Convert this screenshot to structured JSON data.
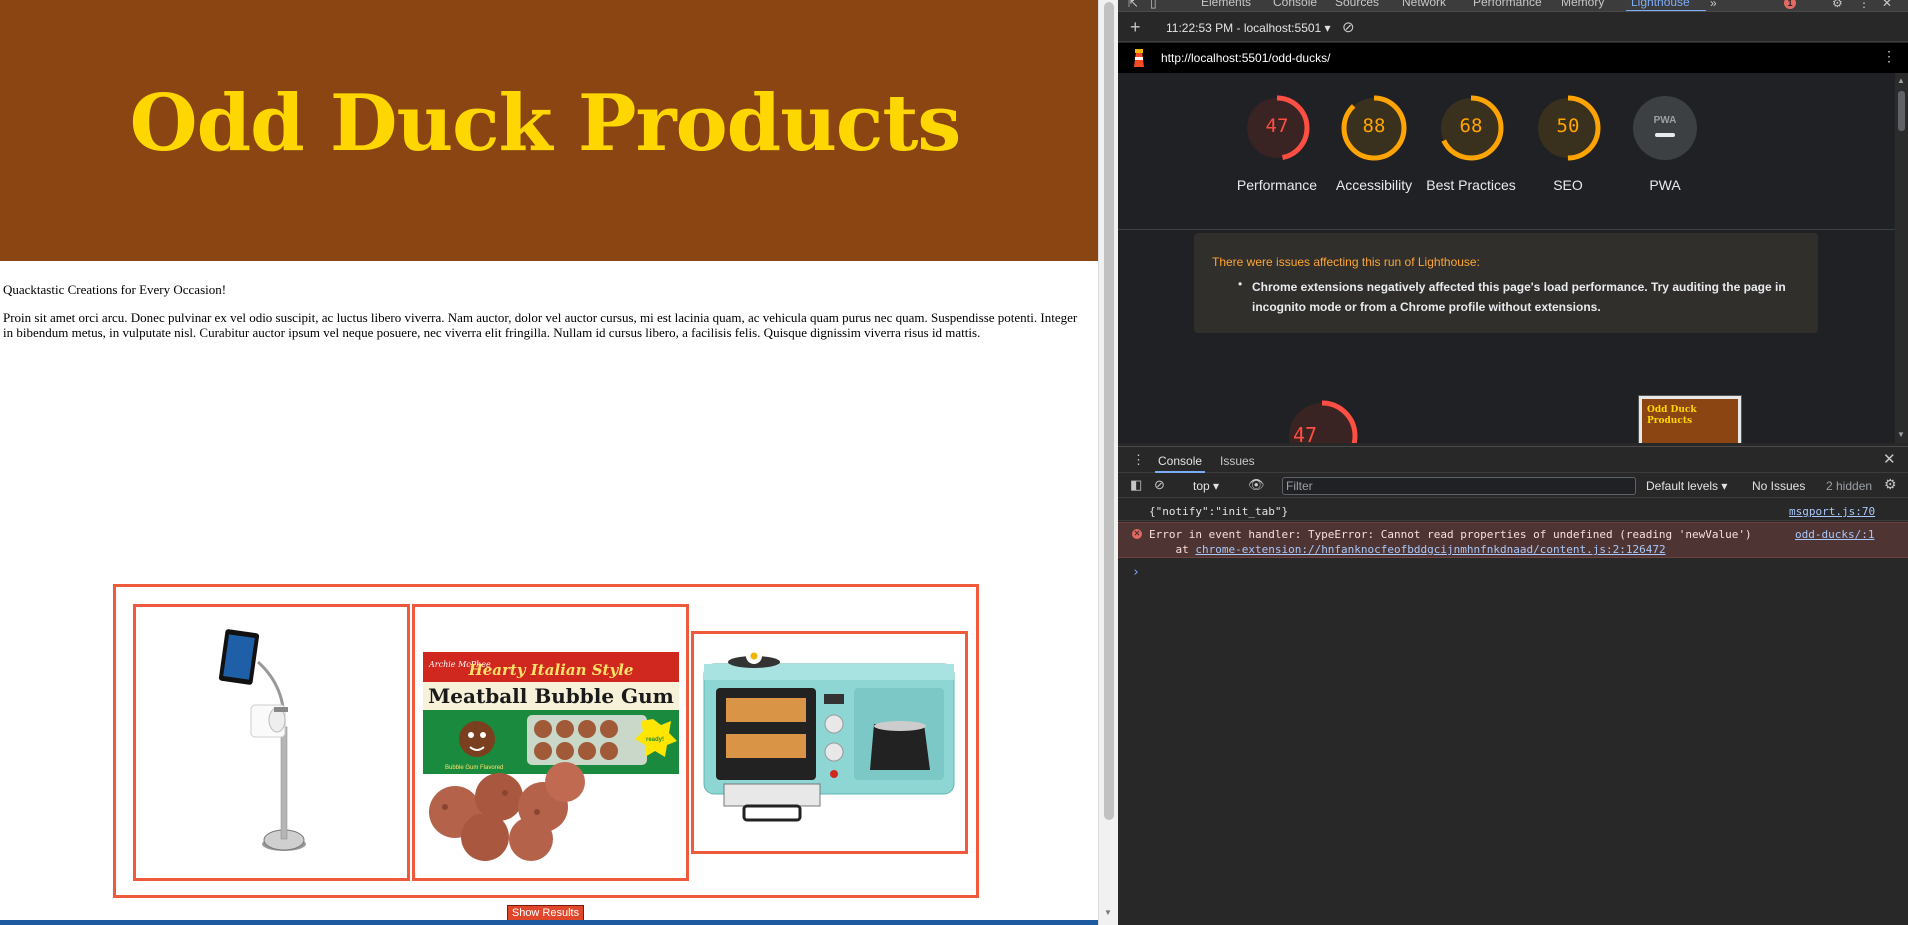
{
  "page": {
    "title": "Odd Duck Products",
    "tagline": "Quacktastic Creations for Every Occasion!",
    "description": "Proin sit amet orci arcu. Donec pulvinar ex vel odio suscipit, ac luctus libero viverra. Nam auctor, dolor vel auctor cursus, mi est lacinia quam, ac vehicula quam purus nec quam. Suspendisse potenti. Integer in bibendum metus, in vulputate nisl. Curabitur auctor ipsum vel neque posuere, nec viverra elit fringilla. Nullam id cursus libero, a facilisis felis. Quisque dignissim viverra risus id mattis.",
    "products": [
      {
        "name": "tablet-stand-toilet-paper-holder"
      },
      {
        "name": "meatball-bubble-gum",
        "box_brand": "Archie McPhee",
        "box_line1": "Hearty Italian Style",
        "box_line2": "Meatball Bubble Gum",
        "badge": "Fully cooked & ready to chew!",
        "footer": "Bubble Gum Flavored"
      },
      {
        "name": "breakfast-station-toaster-oven"
      }
    ],
    "show_results_label": "Show Results",
    "colors": {
      "header_bg": "#8b4513",
      "title": "#ffd700",
      "border": "#f05a3c"
    }
  },
  "devtools": {
    "tabs": [
      "Elements",
      "Console",
      "Sources",
      "Network",
      "Performance",
      "Memory",
      "Lighthouse"
    ],
    "active_tab": "Lighthouse",
    "more_tabs": "»",
    "error_count": "1",
    "lighthouse": {
      "run_label": "11:22:53 PM - localhost:5501 ▾",
      "url": "http://localhost:5501/odd-ducks/",
      "scores": [
        {
          "label": "Performance",
          "value": 47,
          "color": "#ff4e42"
        },
        {
          "label": "Accessibility",
          "value": 88,
          "color": "#ffa400"
        },
        {
          "label": "Best Practices",
          "value": 68,
          "color": "#ffa400"
        },
        {
          "label": "SEO",
          "value": 50,
          "color": "#ffa400"
        },
        {
          "label": "PWA",
          "value": null,
          "color": "#9aa0a6"
        }
      ],
      "pwa_badge": "PWA",
      "warning_title": "There were issues affecting this run of Lighthouse:",
      "warning_item": "Chrome extensions negatively affected this page's load performance. Try auditing the page in incognito mode or from a Chrome profile without extensions.",
      "main_score": "47",
      "thumb_title": "Odd Duck Products"
    },
    "drawer": {
      "tabs": [
        "Console",
        "Issues"
      ],
      "active_tab": "Console",
      "context": "top ▾",
      "filter_placeholder": "Filter",
      "levels": "Default levels ▾",
      "issues": "No Issues",
      "hidden": "2 hidden",
      "messages": [
        {
          "text": "{\"notify\":\"init_tab\"}",
          "source": "msgport.js:70",
          "level": "info"
        },
        {
          "text": "Error in event handler: TypeError: Cannot read properties of undefined (reading 'newValue')",
          "stack_prefix": "    at ",
          "stack_link": "chrome-extension://hnfanknocfeofbddgcijnmhnfnkdnaad/content.js:2:126472",
          "source": "odd-ducks/:1",
          "level": "error"
        }
      ],
      "prompt": "›"
    }
  }
}
